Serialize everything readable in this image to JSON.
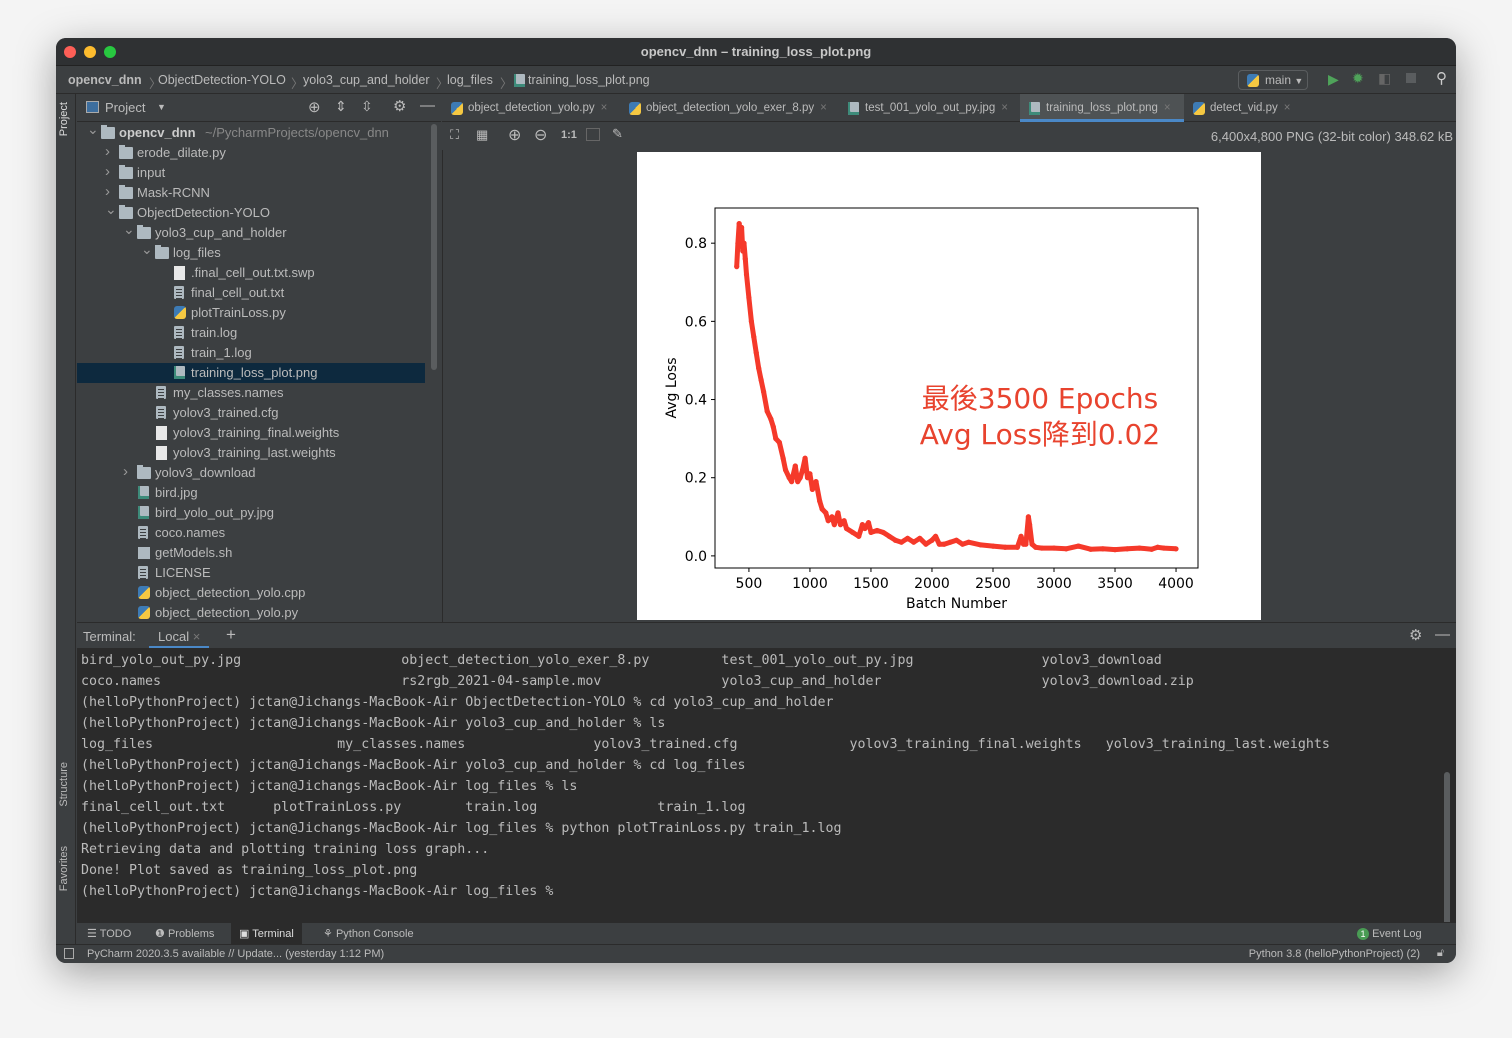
{
  "window": {
    "title": "opencv_dnn – training_loss_plot.png"
  },
  "breadcrumb": [
    "opencv_dnn",
    "ObjectDetection-YOLO",
    "yolo3_cup_and_holder",
    "log_files",
    "training_loss_plot.png"
  ],
  "run": {
    "config": "main"
  },
  "sidebar": {
    "left_labels": [
      "Project",
      "Structure",
      "Favorites"
    ]
  },
  "project": {
    "title": "Project",
    "tree": [
      {
        "label": "opencv_dnn",
        "extra": "~/PycharmProjects/opencv_dnn",
        "level": 0,
        "type": "folder",
        "expanded": true,
        "bold": true
      },
      {
        "label": "erode_dilate.py",
        "level": 1,
        "type": "folder",
        "expanded": false
      },
      {
        "label": "input",
        "level": 1,
        "type": "folder",
        "expanded": false
      },
      {
        "label": "Mask-RCNN",
        "level": 1,
        "type": "folder",
        "expanded": false
      },
      {
        "label": "ObjectDetection-YOLO",
        "level": 1,
        "type": "folder",
        "expanded": true
      },
      {
        "label": "yolo3_cup_and_holder",
        "level": 2,
        "type": "folder",
        "expanded": true
      },
      {
        "label": "log_files",
        "level": 3,
        "type": "folder",
        "expanded": true
      },
      {
        "label": ".final_cell_out.txt.swp",
        "level": 4,
        "type": "blank"
      },
      {
        "label": "final_cell_out.txt",
        "level": 4,
        "type": "txt"
      },
      {
        "label": "plotTrainLoss.py",
        "level": 4,
        "type": "py"
      },
      {
        "label": "train.log",
        "level": 4,
        "type": "txt"
      },
      {
        "label": "train_1.log",
        "level": 4,
        "type": "txt"
      },
      {
        "label": "training_loss_plot.png",
        "level": 4,
        "type": "img",
        "selected": true
      },
      {
        "label": "my_classes.names",
        "level": 3,
        "type": "txt"
      },
      {
        "label": "yolov3_trained.cfg",
        "level": 3,
        "type": "txt"
      },
      {
        "label": "yolov3_training_final.weights",
        "level": 3,
        "type": "blank"
      },
      {
        "label": "yolov3_training_last.weights",
        "level": 3,
        "type": "blank"
      },
      {
        "label": "yolov3_download",
        "level": 2,
        "type": "folder",
        "expanded": false
      },
      {
        "label": "bird.jpg",
        "level": 2,
        "type": "img"
      },
      {
        "label": "bird_yolo_out_py.jpg",
        "level": 2,
        "type": "img"
      },
      {
        "label": "coco.names",
        "level": 2,
        "type": "txt"
      },
      {
        "label": "getModels.sh",
        "level": 2,
        "type": "sh"
      },
      {
        "label": "LICENSE",
        "level": 2,
        "type": "txt"
      },
      {
        "label": "object_detection_yolo.cpp",
        "level": 2,
        "type": "py"
      },
      {
        "label": "object_detection_yolo.py",
        "level": 2,
        "type": "py"
      }
    ]
  },
  "tabs": [
    {
      "label": "object_detection_yolo.py",
      "icon": "python"
    },
    {
      "label": "object_detection_yolo_exer_8.py",
      "icon": "python"
    },
    {
      "label": "test_001_yolo_out_py.jpg",
      "icon": "image"
    },
    {
      "label": "training_loss_plot.png",
      "icon": "image",
      "active": true
    },
    {
      "label": "detect_vid.py",
      "icon": "python"
    }
  ],
  "image_viewer": {
    "zoom_actual": "1:1",
    "info": "6,400x4,800 PNG (32-bit color) 348.62 kB"
  },
  "chart_data": {
    "type": "line",
    "xlabel": "Batch Number",
    "ylabel": "Avg Loss",
    "xlim": [
      222,
      4180
    ],
    "ylim": [
      -0.031,
      0.89
    ],
    "xticks": [
      500,
      1000,
      1500,
      2000,
      2500,
      3000,
      3500,
      4000
    ],
    "yticks": [
      0.0,
      0.2,
      0.4,
      0.6,
      0.8
    ],
    "color": "#f5392a",
    "grid": false,
    "annotation": [
      "最後3500 Epochs",
      "Avg Loss降到0.02"
    ],
    "annotation_color": "#e8432e",
    "x": [
      400,
      410,
      420,
      430,
      440,
      450,
      460,
      470,
      480,
      500,
      520,
      540,
      560,
      580,
      600,
      620,
      650,
      680,
      700,
      720,
      750,
      780,
      800,
      830,
      850,
      880,
      900,
      920,
      940,
      960,
      980,
      1000,
      1020,
      1050,
      1080,
      1100,
      1130,
      1150,
      1180,
      1200,
      1230,
      1250,
      1280,
      1300,
      1350,
      1400,
      1430,
      1450,
      1480,
      1500,
      1550,
      1600,
      1650,
      1700,
      1750,
      1800,
      1850,
      1900,
      1950,
      2000,
      2030,
      2060,
      2100,
      2150,
      2200,
      2250,
      2300,
      2400,
      2500,
      2600,
      2700,
      2730,
      2750,
      2770,
      2790,
      2800,
      2820,
      2850,
      2900,
      3000,
      3100,
      3200,
      3300,
      3400,
      3500,
      3600,
      3700,
      3800,
      3850,
      3900,
      4000
    ],
    "y": [
      0.74,
      0.8,
      0.85,
      0.82,
      0.84,
      0.78,
      0.8,
      0.76,
      0.72,
      0.66,
      0.6,
      0.56,
      0.52,
      0.48,
      0.45,
      0.42,
      0.37,
      0.35,
      0.33,
      0.3,
      0.29,
      0.25,
      0.22,
      0.2,
      0.19,
      0.23,
      0.19,
      0.2,
      0.22,
      0.25,
      0.2,
      0.21,
      0.17,
      0.19,
      0.14,
      0.12,
      0.11,
      0.09,
      0.1,
      0.08,
      0.11,
      0.08,
      0.09,
      0.07,
      0.06,
      0.05,
      0.08,
      0.07,
      0.085,
      0.06,
      0.065,
      0.06,
      0.05,
      0.04,
      0.035,
      0.045,
      0.035,
      0.045,
      0.03,
      0.04,
      0.05,
      0.03,
      0.03,
      0.035,
      0.04,
      0.03,
      0.035,
      0.028,
      0.025,
      0.022,
      0.022,
      0.05,
      0.03,
      0.03,
      0.1,
      0.08,
      0.03,
      0.022,
      0.02,
      0.02,
      0.018,
      0.025,
      0.017,
      0.018,
      0.016,
      0.018,
      0.02,
      0.017,
      0.022,
      0.02,
      0.018
    ]
  },
  "terminal": {
    "label": "Terminal:",
    "tab": "Local",
    "lines": [
      "bird_yolo_out_py.jpg                    object_detection_yolo_exer_8.py         test_001_yolo_out_py.jpg                yolov3_download",
      "coco.names                              rs2rgb_2021-04-sample.mov               yolo3_cup_and_holder                    yolov3_download.zip",
      "(helloPythonProject) jctan@Jichangs-MacBook-Air ObjectDetection-YOLO % cd yolo3_cup_and_holder",
      "(helloPythonProject) jctan@Jichangs-MacBook-Air yolo3_cup_and_holder % ls",
      "log_files                       my_classes.names                yolov3_trained.cfg              yolov3_training_final.weights   yolov3_training_last.weights",
      "(helloPythonProject) jctan@Jichangs-MacBook-Air yolo3_cup_and_holder % cd log_files",
      "(helloPythonProject) jctan@Jichangs-MacBook-Air log_files % ls",
      "final_cell_out.txt      plotTrainLoss.py        train.log               train_1.log",
      "(helloPythonProject) jctan@Jichangs-MacBook-Air log_files % python plotTrainLoss.py train_1.log",
      "Retrieving data and plotting training loss graph...",
      "Done! Plot saved as training_loss_plot.png",
      "(helloPythonProject) jctan@Jichangs-MacBook-Air log_files % "
    ]
  },
  "bottom_tools": {
    "todo": "TODO",
    "problems": "Problems",
    "terminal": "Terminal",
    "python_console": "Python Console",
    "event_log": "Event Log",
    "event_count": "1"
  },
  "status": {
    "message": "PyCharm 2020.3.5 available // Update... (yesterday 1:12 PM)",
    "interpreter": "Python 3.8 (helloPythonProject) (2)"
  }
}
